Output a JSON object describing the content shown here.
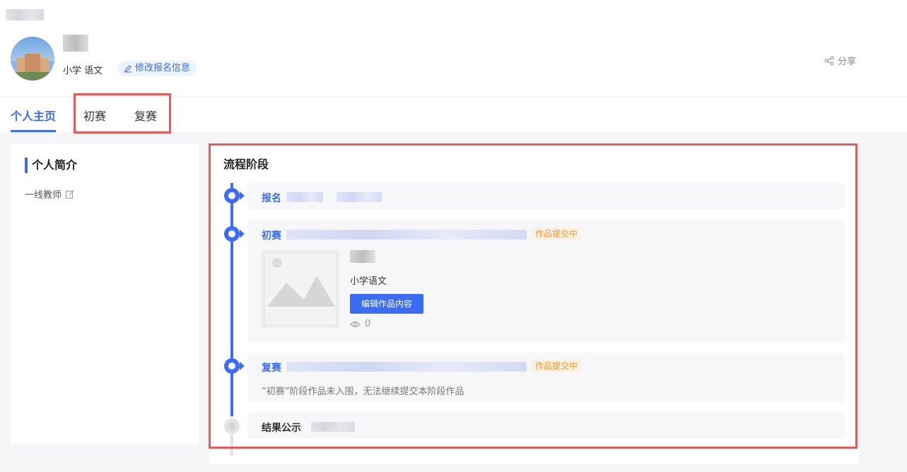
{
  "profile": {
    "subject": "小学 语文",
    "edit_label": "修改报名信息",
    "share_label": "分享"
  },
  "tabs": [
    {
      "label": "个人主页",
      "active": true
    },
    {
      "label": "初赛",
      "active": false
    },
    {
      "label": "复赛",
      "active": false
    }
  ],
  "sidebar": {
    "title": "个人简介",
    "bio": "一线教师"
  },
  "process": {
    "title": "流程阶段",
    "stages": [
      {
        "name": "报名"
      },
      {
        "name": "初赛",
        "status": "作品提交中",
        "work": {
          "subject": "小学语文",
          "edit_button": "编辑作品内容",
          "views": "0"
        }
      },
      {
        "name": "复赛",
        "status": "作品提交中",
        "note": "“初赛”阶段作品未入围，无法继续提交本阶段作品"
      },
      {
        "name": "结果公示"
      }
    ]
  },
  "colors": {
    "accent": "#3a6cf4",
    "tag_text": "#f0962e",
    "tag_bg": "#fdf1e3",
    "highlight": "#e85a5a"
  }
}
